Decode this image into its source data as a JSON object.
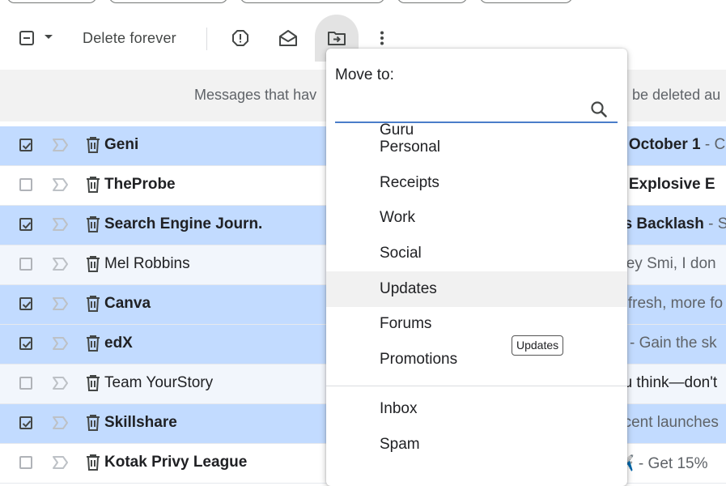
{
  "toolbar": {
    "delete_forever_label": "Delete forever"
  },
  "banner": {
    "text_left": "Messages that hav",
    "text_right": "be deleted au"
  },
  "emails": [
    {
      "sender": "Geni",
      "snippet_subject": "n October 1",
      "snippet_rest": " - C",
      "selected": true,
      "unread": true
    },
    {
      "sender": "TheProbe",
      "snippet_subject": "n Explosive E",
      "snippet_rest": "",
      "selected": false,
      "unread": true
    },
    {
      "sender": "Search Engine Journ.",
      "snippet_subject": "ks Backlash",
      "snippet_rest": " - Se",
      "selected": true,
      "unread": true
    },
    {
      "sender": "Mel Robbins",
      "snippet_subject": "",
      "snippet_rest": "Hey Smi, I don",
      "selected": false,
      "unread": false
    },
    {
      "sender": "Canva",
      "snippet_subject": "",
      "snippet_rest": "n fresh, more fo",
      "selected": true,
      "unread": true
    },
    {
      "sender": "edX",
      "snippet_subject": "X",
      "snippet_rest": " - Gain the sk",
      "selected": true,
      "unread": true
    },
    {
      "sender": "Team YourStory",
      "snippet_subject": "",
      "snippet_rest": "ou think—don't",
      "selected": false,
      "unread": false
    },
    {
      "sender": "Skillshare",
      "snippet_subject": "",
      "snippet_rest": "ecent launches",
      "selected": true,
      "unread": true
    },
    {
      "sender": "Kotak Privy League",
      "snippet_subject": "",
      "snippet_rest": "✈️ - Get 15%",
      "selected": false,
      "unread": true
    }
  ],
  "move_menu": {
    "title": "Move to:",
    "search_value": "",
    "labels": [
      "Guru",
      "Personal",
      "Receipts",
      "Work",
      "Social",
      "Updates",
      "Forums",
      "Promotions"
    ],
    "system": [
      "Inbox",
      "Spam"
    ],
    "hovered": "Updates"
  },
  "tooltip": {
    "text": "Updates"
  },
  "colors": {
    "selected_row": "#c2dbff",
    "unselected_row": "#f2f6fc",
    "search_underline": "#4a7dc9"
  }
}
